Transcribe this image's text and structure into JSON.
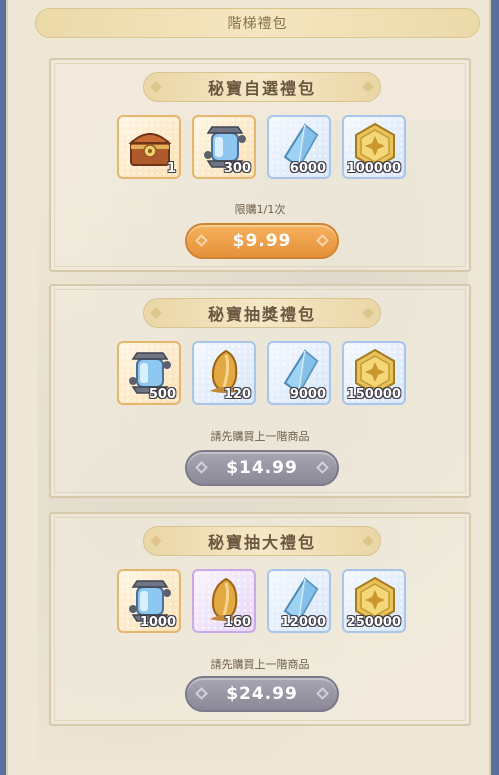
{
  "window": {
    "title": "階梯禮包"
  },
  "tiers": [
    {
      "title": "秘寶自選禮包",
      "items": [
        {
          "icon": "treasure-chest-icon",
          "qty": "1",
          "frame": "gold"
        },
        {
          "icon": "capsule-icon",
          "qty": "300",
          "frame": "gold"
        },
        {
          "icon": "blue-crystal-icon",
          "qty": "6000",
          "frame": "blue"
        },
        {
          "icon": "gold-coin-icon",
          "qty": "100000",
          "frame": "blue"
        }
      ],
      "note": "限購1/1次",
      "price": "$9.99",
      "price_state": "active"
    },
    {
      "title": "秘寶抽獎禮包",
      "items": [
        {
          "icon": "capsule-icon",
          "qty": "500",
          "frame": "gold"
        },
        {
          "icon": "amber-crystal-icon",
          "qty": "120",
          "frame": "blue"
        },
        {
          "icon": "blue-crystal-icon",
          "qty": "9000",
          "frame": "blue"
        },
        {
          "icon": "gold-coin-icon",
          "qty": "150000",
          "frame": "blue"
        }
      ],
      "note": "請先購買上一階商品",
      "price": "$14.99",
      "price_state": "locked"
    },
    {
      "title": "秘寶抽大禮包",
      "items": [
        {
          "icon": "capsule-icon",
          "qty": "1000",
          "frame": "gold"
        },
        {
          "icon": "amber-crystal-icon",
          "qty": "160",
          "frame": "purple"
        },
        {
          "icon": "blue-crystal-icon",
          "qty": "12000",
          "frame": "blue"
        },
        {
          "icon": "gold-coin-icon",
          "qty": "250000",
          "frame": "blue"
        }
      ],
      "note": "請先購買上一階商品",
      "price": "$24.99",
      "price_state": "locked"
    }
  ],
  "colors": {
    "active_price": "#eca14a",
    "locked_price": "#9996a4",
    "panel_bg": "#efe7d6"
  }
}
